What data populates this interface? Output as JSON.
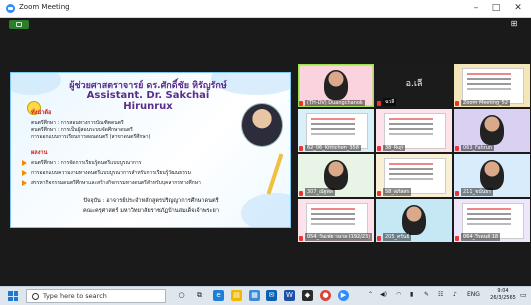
{
  "window": {
    "title": "Zoom Meeting",
    "minimize": "–",
    "maximize": "□",
    "close": "✕"
  },
  "slide": {
    "title_th": "ผู้ช่วยศาสตราจารย์ ดร.ศักดิ์ชัย หิรัญรักษ์",
    "title_en": "Assistant. Dr. Sakchai Hirunrux",
    "education_header": "ทั่งนำต้อ",
    "education_lines": [
      "ตนตรีศึกษา : การสอนทางการบัณฑิตดนตรี",
      "ตนตรีศึกษา : การเป็นผู้สอนระบบจัดศึกษาดนตรี",
      "การออกแบบการเรียนการสอนดนตรี (สาขาดนตรีศึกษา)"
    ],
    "research_header": "ผลงาน",
    "research_lines": [
      "ดนตรีศึกษา : การจัดการเรียนรู้ดนตรีแบบบูรณาการ",
      "การออกแบบความงามทางดนตรีแบบบูรณาการสำหรับการเรียนรู้วัฒนธรรม",
      "สรรหากิจกรรมดนตรีศึกษาและสร้างกิจกรรมทางดนตรีสำหรับบุคลากรทางศึกษา"
    ],
    "footer_line1": "ปัจจุบัน : อาจารย์ประจำหลักสูตรปริญญาการศึกษาดนตรี",
    "footer_line2": "คณะครุศาสตร์ มหาวิทยาลัยราชภัฏบ้านสมเด็จเจ้าพระยา"
  },
  "gallery": [
    {
      "name": "(TH-DV) Duangchanok",
      "kind": "person",
      "bg": "#fbd3df",
      "active": true
    },
    {
      "name": "ฉวลี",
      "kind": "name",
      "display": "อ.เลี",
      "bg": "#1b1b1b"
    },
    {
      "name": "Zoom Meeting_52",
      "kind": "docs",
      "bg": "#f4e6b8"
    },
    {
      "name": "62_06_Kittichon_358",
      "kind": "docs",
      "bg": "#d8f1f9"
    },
    {
      "name": "38_Ruji",
      "kind": "docs",
      "bg": "#fde2ec"
    },
    {
      "name": "063_Fahrun",
      "kind": "person",
      "bg": "#d9d0f2"
    },
    {
      "name": "307_ณัฐพล",
      "kind": "person",
      "bg": "#e8f4e6"
    },
    {
      "name": "58_สุภัสสร",
      "kind": "docs",
      "bg": "#f8efd4"
    },
    {
      "name": "211_ชนันธร",
      "kind": "person",
      "bg": "#d8ecfb"
    },
    {
      "name": "054_วันเฟย วนาล (192/23)",
      "kind": "docs",
      "bg": "#fde2ec"
    },
    {
      "name": "205_ศรันย์",
      "kind": "person",
      "bg": "#c6e8f5"
    },
    {
      "name": "064_วีรดนย์ 18",
      "kind": "docs",
      "bg": "#eee6fa"
    }
  ],
  "taskbar": {
    "search_placeholder": "Type here to search",
    "lang": "ENG",
    "time": "9:04",
    "date": "26/3/2565"
  },
  "colors": {
    "accent": "#2D8CFF",
    "active_speaker": "#9de34a",
    "slide_title": "#5b2d8c",
    "section_red": "#d02020",
    "bullet_orange": "#f08a00"
  },
  "icons": [
    "zoom-logo-icon",
    "share-screen-icon",
    "gallery-view-icon",
    "windows-start-icon",
    "search-icon",
    "mic-muted-icon",
    "taskview-icon",
    "edge-icon",
    "file-explorer-icon",
    "mail-icon",
    "word-icon",
    "chrome-icon",
    "zoom-icon",
    "wifi-icon",
    "speaker-icon",
    "battery-icon",
    "notification-icon"
  ]
}
